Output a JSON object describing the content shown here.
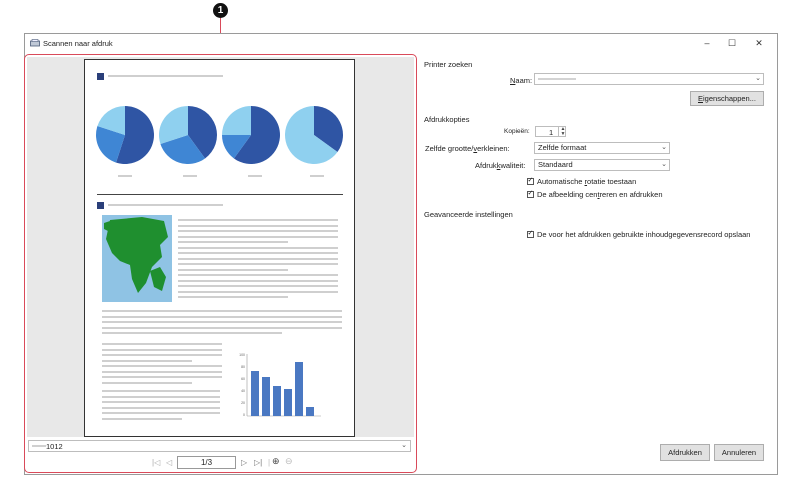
{
  "callout": {
    "number": "1"
  },
  "window": {
    "title": "Scannen naar afdruk",
    "min": "–",
    "max": "☐",
    "close": "✕"
  },
  "preview": {
    "file_combo": "1012",
    "page_indicator": "1/3",
    "bar_chart": {
      "ytick_labels": [
        "100",
        "80",
        "60",
        "40",
        "20",
        "0"
      ],
      "values": [
        75,
        65,
        50,
        45,
        90,
        15
      ]
    }
  },
  "printer": {
    "section": "Printer zoeken",
    "name_label": "Naam:",
    "properties_button": "Eigenschappen..."
  },
  "copies": {
    "section": "Afdrukkopties",
    "copies_label": "Kopieën:",
    "copies_value": "1",
    "scale_label": "Zelfde grootte/verkleinen:",
    "scale_value": "Zelfde formaat",
    "quality_label": "Afdrukkwaliteit:",
    "quality_value": "Standaard",
    "auto_rotate": "Automatische rotatie toestaan",
    "center_image": "De afbeelding centreren en afdrukken"
  },
  "advanced": {
    "section": "Geavanceerde instellingen",
    "save_record": "De voor het afdrukken gebruikte inhoudgegevensrecord opslaan"
  },
  "footer": {
    "print_button": "Afdrukken",
    "cancel_button": "Annuleren"
  },
  "colors": {
    "accent_red": "#d94a5a",
    "pie_dark": "#2f55a4",
    "pie_mid": "#3f86d4",
    "pie_light": "#8fd0ef",
    "bar_blue": "#4a78c2",
    "map_green": "#1f8f2f"
  }
}
